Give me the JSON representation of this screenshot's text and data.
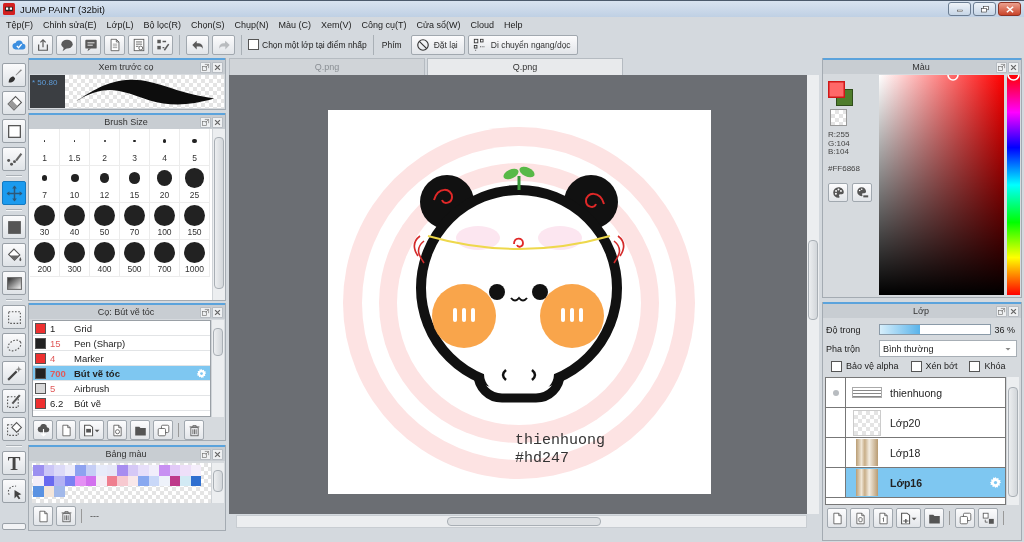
{
  "window": {
    "title": "JUMP PAINT (32bit)"
  },
  "menu": [
    "Tệp(F)",
    "Chỉnh sửa(E)",
    "Lớp(L)",
    "Bộ lọc(R)",
    "Chọn(S)",
    "Chụp(N)",
    "Màu (C)",
    "Xem(V)",
    "Công cụ(T)",
    "Cửa sổ(W)",
    "Cloud",
    "Help"
  ],
  "toolbar": {
    "undo": {
      "disabled": false
    },
    "redo": {
      "disabled": true
    },
    "pick_layer": {
      "label": "Chọn một lớp tại điểm nhấp",
      "checked": false
    },
    "keys_label": "Phím",
    "reset_button": "Đặt lại",
    "move_button": "Di chuyển ngang/dọc"
  },
  "tool_groups": [
    [
      {
        "kind": "brush",
        "selected": false
      },
      {
        "kind": "eraser",
        "selected": false
      },
      {
        "kind": "shape",
        "selected": false
      },
      {
        "kind": "dot-pen",
        "selected": false
      }
    ],
    [
      {
        "kind": "move",
        "selected": true
      }
    ],
    [
      {
        "kind": "fill",
        "selected": false
      },
      {
        "kind": "bucket",
        "selected": false
      },
      {
        "kind": "gradient",
        "selected": false
      }
    ],
    [
      {
        "kind": "rect-select",
        "selected": false
      },
      {
        "kind": "lasso",
        "selected": false
      },
      {
        "kind": "magic-wand",
        "selected": false
      },
      {
        "kind": "select-pen",
        "selected": false
      },
      {
        "kind": "select-eraser",
        "selected": false
      }
    ],
    [
      {
        "kind": "text",
        "glyph": "T",
        "selected": false
      },
      {
        "kind": "select-transform",
        "selected": false
      }
    ]
  ],
  "brush_preview": {
    "title": "Xem trước cọ",
    "size": "* 50.80"
  },
  "brush_size": {
    "title": "Brush Size",
    "sizes": [
      "1",
      "1.5",
      "2",
      "3",
      "4",
      "5",
      "7",
      "10",
      "12",
      "15",
      "20",
      "25",
      "30",
      "40",
      "50",
      "70",
      "100",
      "150",
      "200",
      "300",
      "400",
      "500",
      "700",
      "1000"
    ]
  },
  "brushes": {
    "title": "Cọ: Bút vẽ tóc",
    "items": [
      {
        "color": "#ee3030",
        "size": "1",
        "size_highlighted": false,
        "name": "Grid",
        "selected": false
      },
      {
        "color": "#222222",
        "size": "15",
        "size_highlighted": true,
        "name": "Pen (Sharp)",
        "selected": false
      },
      {
        "color": "#ee3030",
        "size": "4",
        "size_highlighted": true,
        "name": "Marker",
        "selected": false
      },
      {
        "color": "#222222",
        "size": "700",
        "size_highlighted": true,
        "name": "Bút vẽ tóc",
        "selected": true
      },
      {
        "color": "#d8d8d8",
        "size": "5",
        "size_highlighted": true,
        "name": "Airbrush",
        "selected": false
      },
      {
        "color": "#ee3030",
        "size": "6.2",
        "size_highlighted": false,
        "name": "Bút vẽ",
        "selected": false
      }
    ]
  },
  "palette": {
    "title": "Bảng màu",
    "swatches": [
      {
        "color": "#9b8ff0"
      },
      {
        "color": "#cbc6f7"
      },
      {
        "color": "#dcdaf8"
      },
      {
        "color": "#ecebfa"
      },
      {
        "color": "#8ea2f0"
      },
      {
        "color": "#c5cef6"
      },
      {
        "color": "#e7ebfa"
      },
      {
        "color": "#e6e7f8"
      },
      {
        "color": "#a78df0"
      },
      {
        "color": "#d5c8f6"
      },
      {
        "color": "#e7dffa"
      },
      {
        "color": "#f1eefb"
      },
      {
        "color": "#c890f2"
      },
      {
        "color": "#e2c9f7"
      },
      {
        "color": "#eedff9"
      },
      {
        "color": "#f5eefb"
      },
      {
        "color": "#f4eef8"
      },
      {
        "color": "#6a6af0"
      },
      {
        "color": "#b2b1f4"
      },
      {
        "color": "#7a80f2"
      },
      {
        "color": "#e490f4"
      },
      {
        "color": "#d270ee"
      },
      {
        "color": "#f5ecf5"
      },
      {
        "color": "#ef7f8f"
      },
      {
        "color": "#f7c9d0"
      },
      {
        "color": "#f9e8ea"
      },
      {
        "color": "#88a8f0"
      },
      {
        "color": "#c9d8f8"
      },
      {
        "color": "#eef2fa"
      },
      {
        "color": "#be3a8a"
      },
      {
        "color": "#d2eaf4"
      },
      {
        "color": "#2f6fd0"
      },
      {
        "color": "#5a92e2"
      },
      {
        "color": "#f4e6da"
      },
      {
        "color": "#a2b9ea"
      }
    ],
    "status": "---"
  },
  "tabs": [
    {
      "label": "Q.png",
      "selected": false
    },
    {
      "label": "Q.png",
      "selected": true
    }
  ],
  "canvas": {
    "signature": [
      "thienhuong",
      "#hd247"
    ]
  },
  "color": {
    "title": "Màu",
    "foreground": {
      "color": "#ff6868"
    },
    "background": {
      "color": "#4f7d2c"
    },
    "rgb": [
      "R:255",
      "G:104",
      "B:104"
    ],
    "hex": "#FF6868",
    "hue": {
      "level": 0
    }
  },
  "layers": {
    "title": "Lớp",
    "opacity_label": "Độ trong",
    "opacity": {
      "level": 0.36
    },
    "opacity_value": "36 %",
    "blend_label": "Pha trộn",
    "blend_value": "Bình thường",
    "checks": [
      {
        "label": "Bảo vệ alpha",
        "checked": false
      },
      {
        "label": "Xén bớt",
        "checked": false
      },
      {
        "label": "Khóa",
        "checked": false
      }
    ],
    "items": [
      {
        "name": "thienhuong",
        "thumbnail": {
          "kind": "text"
        },
        "marked": true,
        "selected": false
      },
      {
        "name": "Lớp20",
        "thumbnail": {
          "kind": "empty"
        },
        "marked": false,
        "selected": false
      },
      {
        "name": "Lớp18",
        "thumbnail": {
          "kind": "image"
        },
        "marked": false,
        "selected": false
      },
      {
        "name": "Lớp16",
        "thumbnail": {
          "kind": "image"
        },
        "marked": false,
        "selected": true
      }
    ]
  }
}
